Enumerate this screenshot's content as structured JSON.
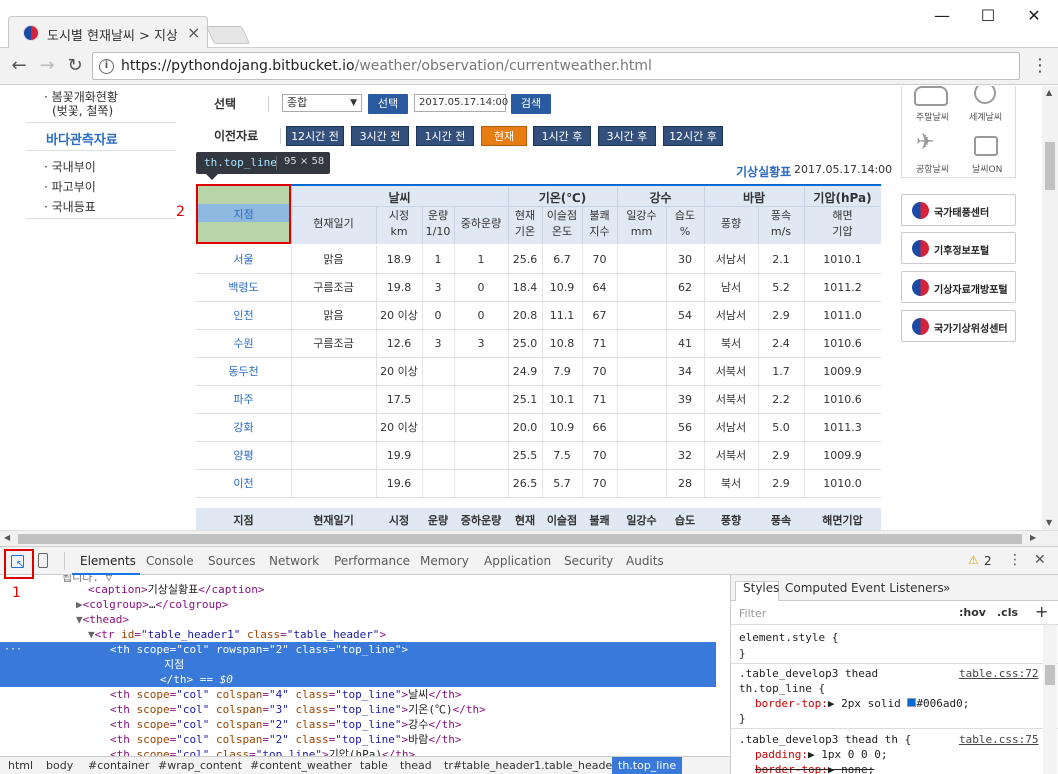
{
  "browser": {
    "tab_title": "도시별 현재날씨 > 지상",
    "tab_close": "×",
    "window_controls": {
      "minimize": "—",
      "maximize": "☐",
      "close": "✕"
    },
    "url_host": "https://pythondojang.bitbucket.io",
    "url_path": "/weather/observation/currentweather.html",
    "back": "←",
    "forward": "→",
    "reload": "↻",
    "info": "i",
    "menu": "⋮"
  },
  "left_menu": {
    "items_top": [
      "· 봄꽃개화현황",
      "(벚꽃, 철쭉)"
    ],
    "section": "바다관측자료",
    "items": [
      "· 국내부이",
      "· 파고부이",
      "· 국내등표"
    ]
  },
  "search": {
    "select_label": "선택",
    "select_value": "종합",
    "select_btn": "선택",
    "datetime": "2017.05.17.14:00",
    "search_btn": "검색",
    "prev_label": "이전자료",
    "nav": [
      "12시간 전",
      "3시간 전",
      "1시간 전",
      "현재",
      "1시간 후",
      "3시간 후",
      "12시간 후"
    ]
  },
  "caption": {
    "title": "기상실황표",
    "datetime": "2017.05.17.14:00"
  },
  "table": {
    "group_headers": [
      "지점",
      "날씨",
      "기온(℃)",
      "강수",
      "바람",
      "기압(hPa)"
    ],
    "sub_headers": [
      "현재일기",
      "시정\nkm",
      "운량\n1/10",
      "중하운량",
      "현재\n기온",
      "이슬점\n온도",
      "불쾌\n지수",
      "일강수\nmm",
      "습도\n%",
      "풍향",
      "풍속\nm/s",
      "해면\n기압"
    ],
    "rows": [
      [
        "서울",
        "맑음",
        "18.9",
        "1",
        "1",
        "25.6",
        "6.7",
        "70",
        "",
        "30",
        "서남서",
        "2.1",
        "1010.1"
      ],
      [
        "백령도",
        "구름조금",
        "19.8",
        "3",
        "0",
        "18.4",
        "10.9",
        "64",
        "",
        "62",
        "남서",
        "5.2",
        "1011.2"
      ],
      [
        "인천",
        "맑음",
        "20 이상",
        "0",
        "0",
        "20.8",
        "11.1",
        "67",
        "",
        "54",
        "서남서",
        "2.9",
        "1011.0"
      ],
      [
        "수원",
        "구름조금",
        "12.6",
        "3",
        "3",
        "25.0",
        "10.8",
        "71",
        "",
        "41",
        "북서",
        "2.4",
        "1010.6"
      ],
      [
        "동두천",
        "",
        "20 이상",
        "",
        "",
        "24.9",
        "7.9",
        "70",
        "",
        "34",
        "서북서",
        "1.7",
        "1009.9"
      ],
      [
        "파주",
        "",
        "17.5",
        "",
        "",
        "25.1",
        "10.1",
        "71",
        "",
        "39",
        "서북서",
        "2.2",
        "1010.6"
      ],
      [
        "강화",
        "",
        "20 이상",
        "",
        "",
        "20.0",
        "10.9",
        "66",
        "",
        "56",
        "서남서",
        "5.0",
        "1011.3"
      ],
      [
        "양평",
        "",
        "19.9",
        "",
        "",
        "25.5",
        "7.5",
        "70",
        "",
        "32",
        "서북서",
        "2.9",
        "1009.9"
      ],
      [
        "이천",
        "",
        "19.6",
        "",
        "",
        "26.5",
        "5.7",
        "70",
        "",
        "28",
        "북서",
        "2.9",
        "1010.0"
      ]
    ],
    "footer_headers": [
      "지점",
      "현재일기",
      "시정",
      "운량",
      "중하운량",
      "현재\n기온",
      "이슬점\n온도",
      "불쾌\n지수",
      "일강수",
      "습도",
      "풍향",
      "풍속",
      "해면기압"
    ]
  },
  "right_panel": {
    "icons": [
      "주말날씨",
      "세계날씨",
      "공항날씨",
      "날씨ON"
    ],
    "banners": [
      "국가태풍센터",
      "기후정보포털",
      "기상자료개방포털",
      "국가기상위성센터"
    ]
  },
  "inspector": {
    "tooltip_selector": "th.top_line",
    "tooltip_size": "95 × 58",
    "label_1": "1",
    "label_2": "2"
  },
  "devtools": {
    "tabs": [
      "Elements",
      "Console",
      "Sources",
      "Network",
      "Performance",
      "Memory",
      "Application",
      "Security",
      "Audits"
    ],
    "warnings": "2",
    "close": "✕",
    "menu": "⋮",
    "breadcrumb": [
      "html",
      "body",
      "#container",
      "#wrap_content",
      "#content_weather",
      "table",
      "thead",
      "tr#table_header1.table_header",
      "th.top_line"
    ],
    "styles_tabs": [
      "Styles",
      "Computed",
      "Event Listeners",
      "»"
    ],
    "filter_placeholder": "Filter",
    "hov": ":hov",
    "cls": ".cls",
    "plus": "+",
    "rules": {
      "r1_selector": "element.style {",
      "r1_close": "}",
      "r2_selector1": ".table_develop3 thead",
      "r2_selector2": "th.top_line {",
      "r2_link": "table.css:72",
      "r2_prop": "border-top:",
      "r2_val": "2px solid",
      "r2_color": "#006ad0;",
      "r2_close": "}",
      "r3_selector": ".table_develop3 thead th {",
      "r3_link": "table.css:75",
      "r3_prop1": "padding:",
      "r3_val1": "1px 0 0 0;",
      "r3_prop2": "border-top:",
      "r3_val2": "none;"
    }
  }
}
